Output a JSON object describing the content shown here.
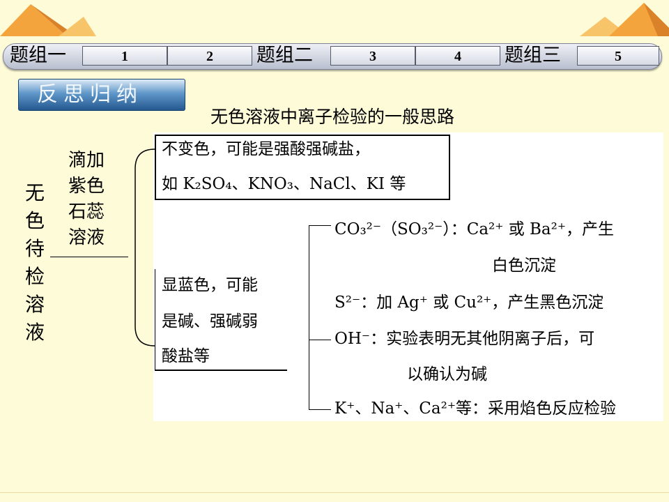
{
  "nav": {
    "groups": [
      {
        "label": "题组一",
        "items": [
          "1",
          "2"
        ]
      },
      {
        "label": "题组二",
        "items": [
          "3",
          "4"
        ]
      },
      {
        "label": "题组三",
        "items": [
          "5"
        ]
      }
    ]
  },
  "banner": {
    "label": "反思归纳"
  },
  "title": "无色溶液中离子检验的一般思路",
  "left": {
    "sample": "无色待检溶液",
    "step": "滴加紫色石蕊溶液"
  },
  "branch_no_change": {
    "line1": "不变色，可能是强酸强碱盐，",
    "line2_prefix": "如 ",
    "examples": [
      "K₂SO₄",
      "KNO₃",
      "NaCl",
      "KI"
    ],
    "line2_suffix": "等"
  },
  "branch_blue": {
    "line1": "显蓝色，可能",
    "line2": "是碱、强碱弱",
    "line3": "酸盐等"
  },
  "tests": {
    "carbonate": {
      "ions": "CO₃²⁻（SO₃²⁻）",
      "text": "：Ca²⁺ 或 Ba²⁺，产生",
      "text2": "白色沉淀"
    },
    "sulfide": {
      "ion": "S²⁻",
      "text": "：加 Ag⁺ 或 Cu²⁺，产生黑色沉淀"
    },
    "hydroxide": {
      "ion": "OH⁻",
      "text": "：实验表明无其他阴离子后，可",
      "text2": "以确认为碱"
    },
    "cations": {
      "ions": "K⁺、Na⁺、Ca²⁺等",
      "text": "：采用焰色反应检验"
    }
  }
}
